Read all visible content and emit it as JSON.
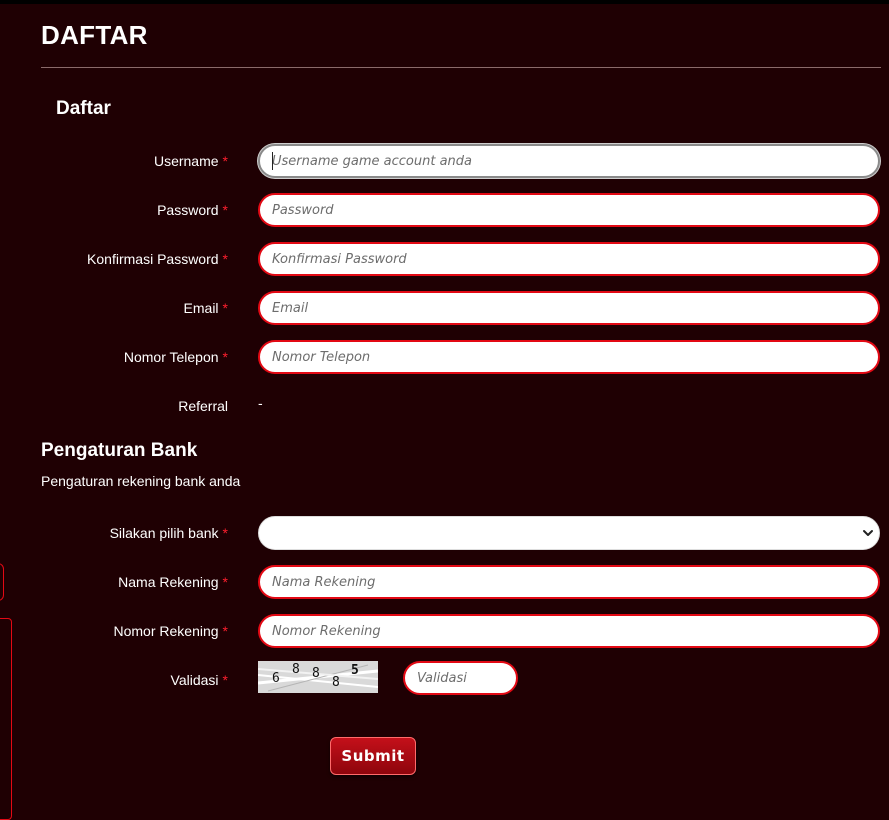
{
  "page": {
    "title": "DAFTAR"
  },
  "form": {
    "section_title": "Daftar",
    "required_mark": "*",
    "fields": [
      {
        "label": "Username",
        "placeholder": "Username game account anda"
      },
      {
        "label": "Password",
        "placeholder": "Password"
      },
      {
        "label": "Konfirmasi Password",
        "placeholder": "Konfirmasi Password"
      },
      {
        "label": "Email",
        "placeholder": "Email"
      },
      {
        "label": "Nomor Telepon",
        "placeholder": "Nomor Telepon"
      }
    ],
    "referral": {
      "label": "Referral",
      "value": "-"
    }
  },
  "bank": {
    "title": "Pengaturan Bank",
    "subtitle": "Pengaturan rekening bank anda",
    "select_label": "Silakan pilih bank",
    "select_value": "",
    "fields": [
      {
        "label": "Nama Rekening",
        "placeholder": "Nama Rekening"
      },
      {
        "label": "Nomor Rekening",
        "placeholder": "Nomor Rekening"
      }
    ],
    "validation": {
      "label": "Validasi",
      "captcha_digits": [
        "6",
        "8",
        "8",
        "8",
        "5"
      ],
      "placeholder": "Validasi"
    }
  },
  "actions": {
    "submit_label": "Submit"
  },
  "colors": {
    "background": "#1f0003",
    "accent": "#e30914",
    "required": "#ff1f2e"
  }
}
